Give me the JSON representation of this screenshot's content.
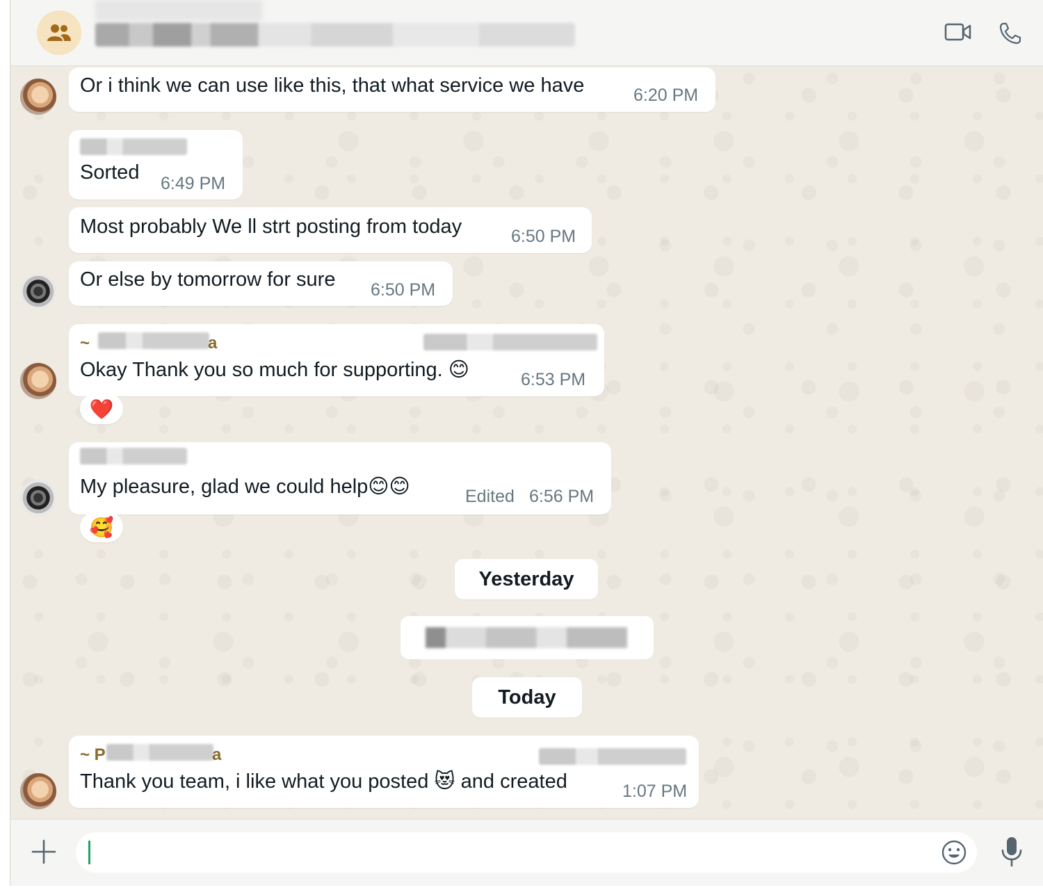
{
  "header": {
    "group_icon": "group-icon",
    "video_icon": "video-camera-icon",
    "call_icon": "phone-icon"
  },
  "messages": [
    {
      "text": "Or i think we can use like this, that what service we have",
      "time": "6:20 PM"
    },
    {
      "text": "Sorted",
      "time": "6:49 PM"
    },
    {
      "text": "Most probably We ll strt posting from today",
      "time": "6:50 PM"
    },
    {
      "text": "Or else by tomorrow for sure",
      "time": "6:50 PM"
    },
    {
      "sender_prefix": "~",
      "sender_suffix": "a",
      "text": "Okay Thank you so much for supporting. 😊",
      "time": "6:53 PM",
      "reaction": "❤️"
    },
    {
      "text": "My pleasure, glad we could help😊😊",
      "edited": "Edited",
      "time": "6:56 PM",
      "reaction": "🥰"
    },
    {
      "sender_prefix": "~ P",
      "sender_suffix": "a",
      "text": "Thank you team, i like what you posted 😻 and created",
      "time": "1:07 PM"
    }
  ],
  "dates": {
    "yesterday": "Yesterday",
    "today": "Today"
  },
  "composer": {
    "placeholder": "",
    "attach_icon": "plus-icon",
    "emoji_icon": "emoji-icon",
    "mic_icon": "microphone-icon"
  },
  "colors": {
    "chat_background": "#efeae2",
    "bubble": "#ffffff",
    "timestamp": "#667781",
    "caret": "#21a366"
  }
}
